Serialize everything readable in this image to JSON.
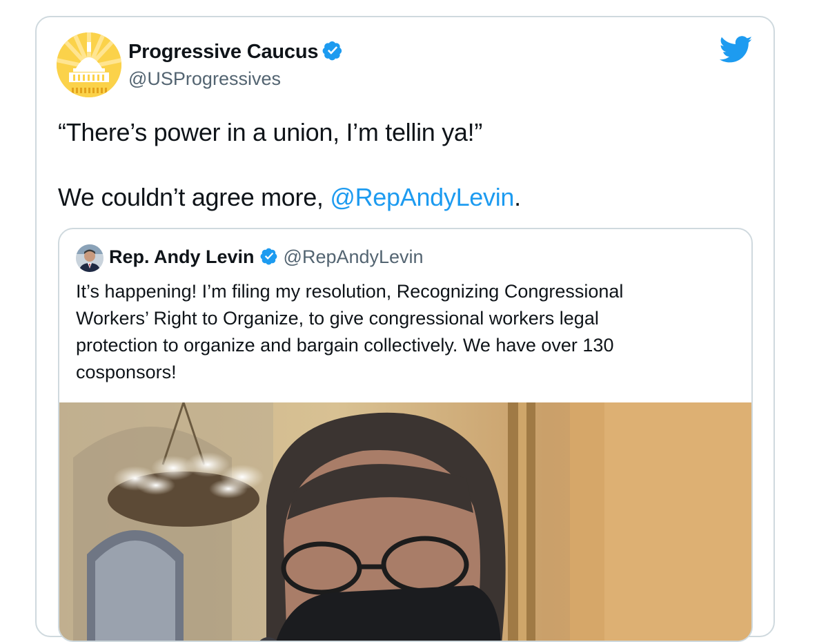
{
  "tweet": {
    "author_name": "Progressive Caucus",
    "author_handle": "@USProgressives",
    "text_line1": "“There’s power in a union, I’m tellin ya!”",
    "text_line2_prefix": "We couldn’t agree more, ",
    "text_line2_mention": "@RepAndyLevin",
    "text_line2_suffix": "."
  },
  "quoted": {
    "author_name": "Rep. Andy Levin",
    "author_handle": "@RepAndyLevin",
    "text_lines": [
      "It’s happening! I’m filing my resolution, Recognizing Congressional",
      "Workers’ Right to Organize, to give congressional workers legal",
      "protection to organize and bargain collectively. We have over 130",
      "cosponsors!"
    ]
  },
  "icons": {
    "verified": "verified-badge-icon",
    "twitter": "twitter-bird-icon"
  },
  "colors": {
    "accent": "#1d9bf0",
    "text": "#0f1419",
    "secondary": "#536471",
    "border": "#cfd9de",
    "avatar_gold": "#fbd24a"
  }
}
